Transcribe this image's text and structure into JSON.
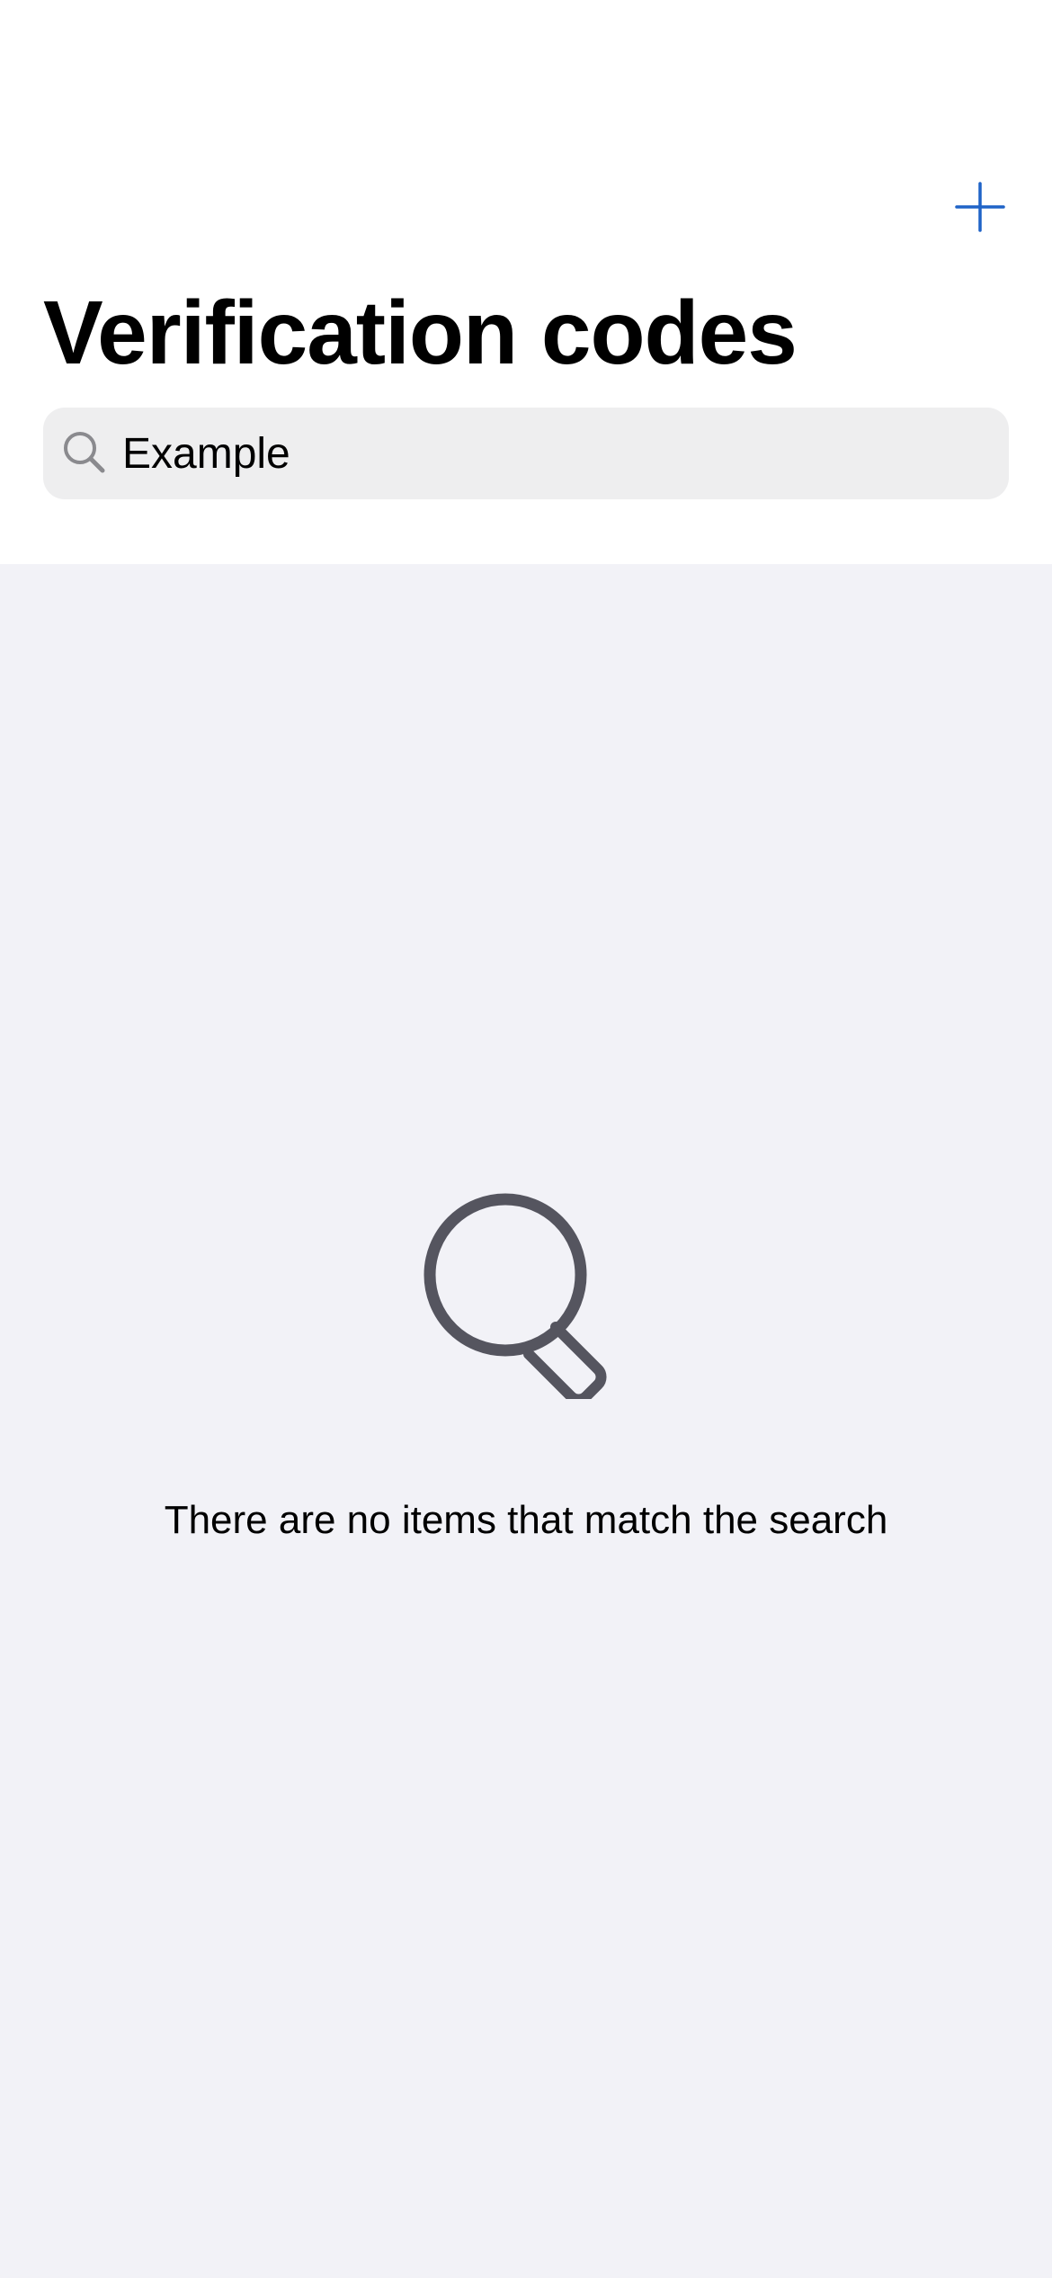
{
  "header": {
    "title": "Verification codes",
    "add_button_icon": "plus-icon"
  },
  "search": {
    "value": "Example",
    "icon": "search-icon"
  },
  "empty_state": {
    "icon": "magnifying-glass-icon",
    "message": "There are no items that match the search"
  },
  "colors": {
    "accent": "#1f63c7",
    "header_background": "#ffffff",
    "content_background": "#f2f2f7",
    "search_field_background": "#eeeeef",
    "empty_icon": "#55555f"
  }
}
